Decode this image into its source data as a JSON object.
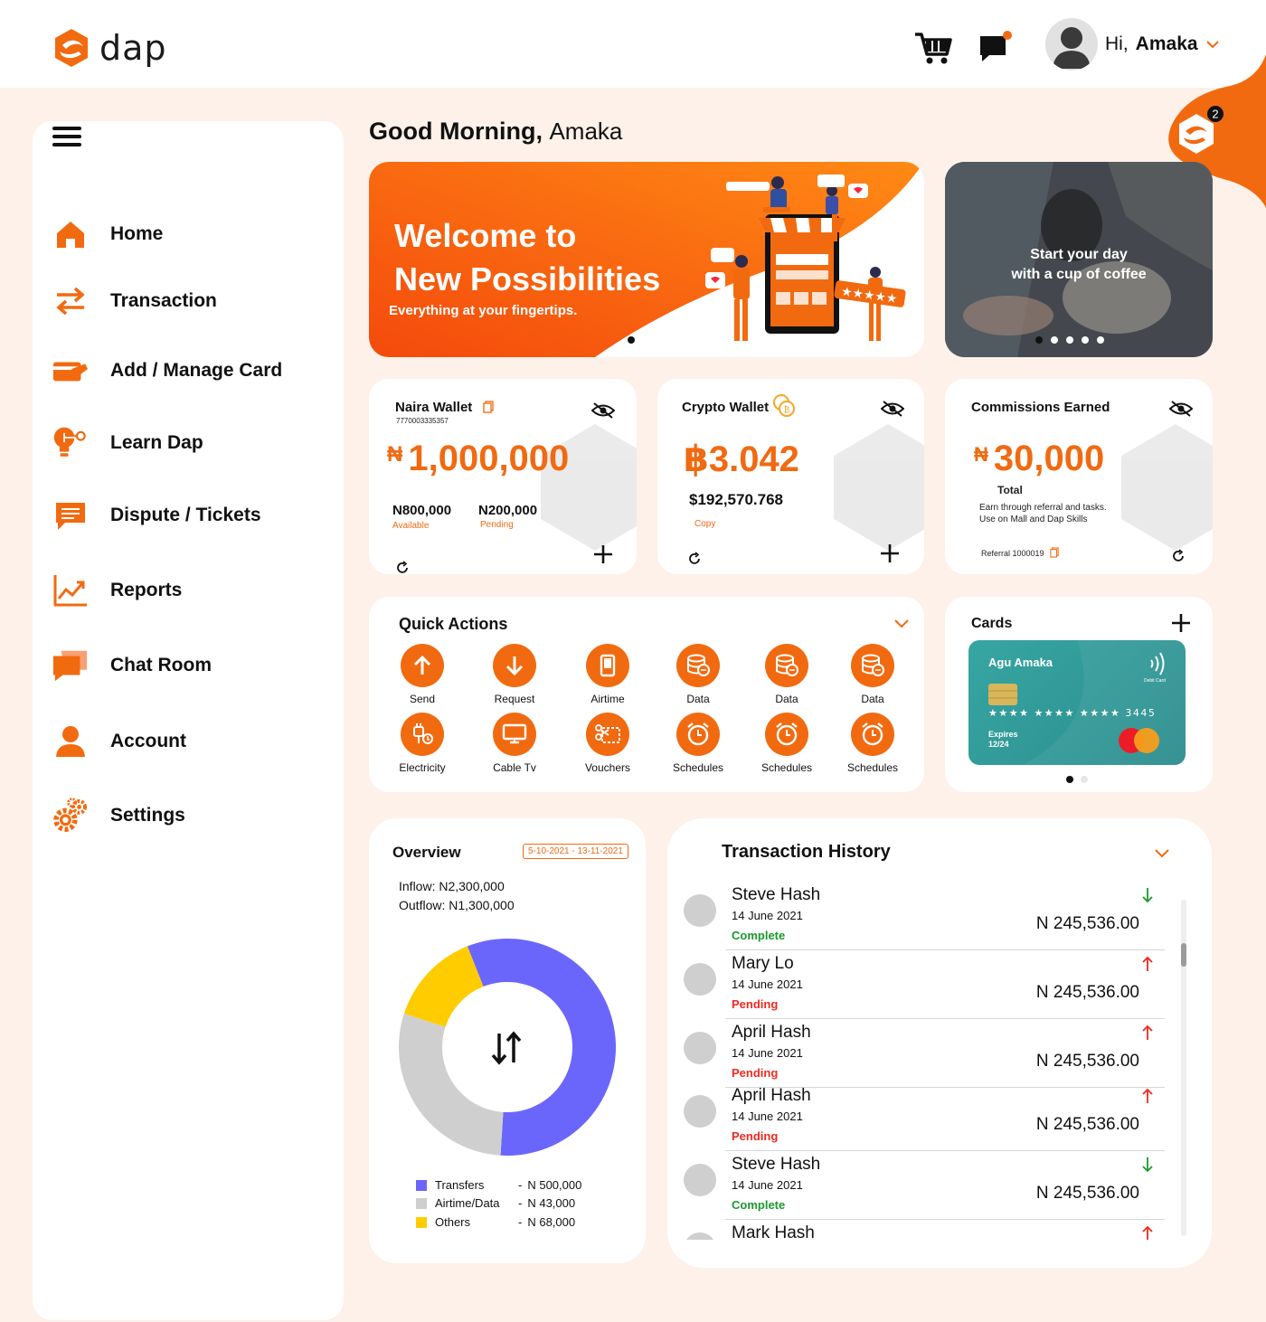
{
  "brand": {
    "name": "dap",
    "accent": "#f26a10"
  },
  "header": {
    "greeting_prefix": "Hi,",
    "user_name": "Amaka",
    "notification_count": "2"
  },
  "sidebar": {
    "items": [
      {
        "label": "Home",
        "icon": "home-icon"
      },
      {
        "label": "Transaction",
        "icon": "transfer-arrows-icon"
      },
      {
        "label": "Add / Manage Card",
        "icon": "card-icon"
      },
      {
        "label": "Learn Dap",
        "icon": "lightbulb-icon"
      },
      {
        "label": "Dispute / Tickets",
        "icon": "message-icon"
      },
      {
        "label": "Reports",
        "icon": "chart-icon"
      },
      {
        "label": "Chat Room",
        "icon": "chat-icon"
      },
      {
        "label": "Account",
        "icon": "user-icon"
      },
      {
        "label": "Settings",
        "icon": "gear-icon"
      }
    ]
  },
  "main": {
    "greeting": "Good Morning,",
    "greeting_name": "Amaka"
  },
  "hero": {
    "title_line1": "Welcome to",
    "title_line2": "New Possibilities",
    "subtitle": "Everything at your fingertips."
  },
  "promo": {
    "line1": "Start your day",
    "line2": "with a cup of coffee"
  },
  "naira_wallet": {
    "title": "Naira Wallet",
    "account_number": "7770003335357",
    "currency_symbol": "₦",
    "balance": "1,000,000",
    "available": "N800,000",
    "available_label": "Available",
    "pending": "N200,000",
    "pending_label": "Pending"
  },
  "crypto_wallet": {
    "title": "Crypto Wallet",
    "balance": "฿3.042",
    "usd_value": "$192,570.768",
    "copy_label": "Copy"
  },
  "commissions": {
    "title": "Commissions Earned",
    "currency_symbol": "₦",
    "amount": "30,000",
    "total_label": "Total",
    "note_line1": "Earn through referral and tasks.",
    "note_line2": "Use on Mall and Dap Skills",
    "referral": "Referral 1000019"
  },
  "quick_actions": {
    "title": "Quick Actions",
    "items": [
      {
        "label": "Send",
        "icon": "arrow-up-icon"
      },
      {
        "label": "Request",
        "icon": "arrow-down-icon"
      },
      {
        "label": "Airtime",
        "icon": "phone-icon"
      },
      {
        "label": "Data",
        "icon": "database-icon"
      },
      {
        "label": "Data",
        "icon": "database-icon"
      },
      {
        "label": "Data",
        "icon": "database-icon"
      },
      {
        "label": "Electricity",
        "icon": "plug-icon"
      },
      {
        "label": "Cable Tv",
        "icon": "tv-icon"
      },
      {
        "label": "Vouchers",
        "icon": "voucher-icon"
      },
      {
        "label": "Schedules",
        "icon": "alarm-icon"
      },
      {
        "label": "Schedules",
        "icon": "alarm-icon"
      },
      {
        "label": "Schedules",
        "icon": "alarm-icon"
      }
    ]
  },
  "cards": {
    "title": "Cards",
    "holder": "Agu Amaka",
    "card_type": "Debit Card",
    "masked_number": "★★★★ ★★★★ ★★★★ 3445",
    "expires_label": "Expires",
    "expiry": "12/24"
  },
  "overview": {
    "title": "Overview",
    "date_range": "5-10-2021 - 13-11-2021",
    "inflow": "Inflow: N2,300,000",
    "outflow": "Outflow: N1,300,000",
    "legend": [
      {
        "name": "Transfers",
        "value": "N 500,000",
        "color": "#6b66fb"
      },
      {
        "name": "Airtime/Data",
        "value": "N 43,000",
        "color": "#cfcfcf"
      },
      {
        "name": "Others",
        "value": "N 68,000",
        "color": "#ffcc00"
      }
    ]
  },
  "chart_data": {
    "type": "pie",
    "categories": [
      "Transfers",
      "Airtime/Data",
      "Others"
    ],
    "values": [
      0.57,
      0.29,
      0.14
    ],
    "colors": [
      "#6b66fb",
      "#cfcfcf",
      "#ffcc00"
    ]
  },
  "transactions": {
    "title": "Transaction History",
    "items": [
      {
        "name": "Steve Hash",
        "date": "14 June 2021",
        "status": "Complete",
        "amount": "N 245,536.00",
        "direction": "down"
      },
      {
        "name": "Mary Lo",
        "date": "14 June 2021",
        "status": "Pending",
        "amount": "N 245,536.00",
        "direction": "up"
      },
      {
        "name": "April Hash",
        "date": "14 June 2021",
        "status": "Pending",
        "amount": "N 245,536.00",
        "direction": "up"
      },
      {
        "name": "April Hash",
        "date": "14 June 2021",
        "status": "Pending",
        "amount": "N 245,536.00",
        "direction": "up"
      },
      {
        "name": "Steve Hash",
        "date": "14 June 2021",
        "status": "Complete",
        "amount": "N 245,536.00",
        "direction": "down"
      },
      {
        "name": "Mark Hash",
        "date": "",
        "status": "",
        "amount": "",
        "direction": "up"
      }
    ]
  }
}
